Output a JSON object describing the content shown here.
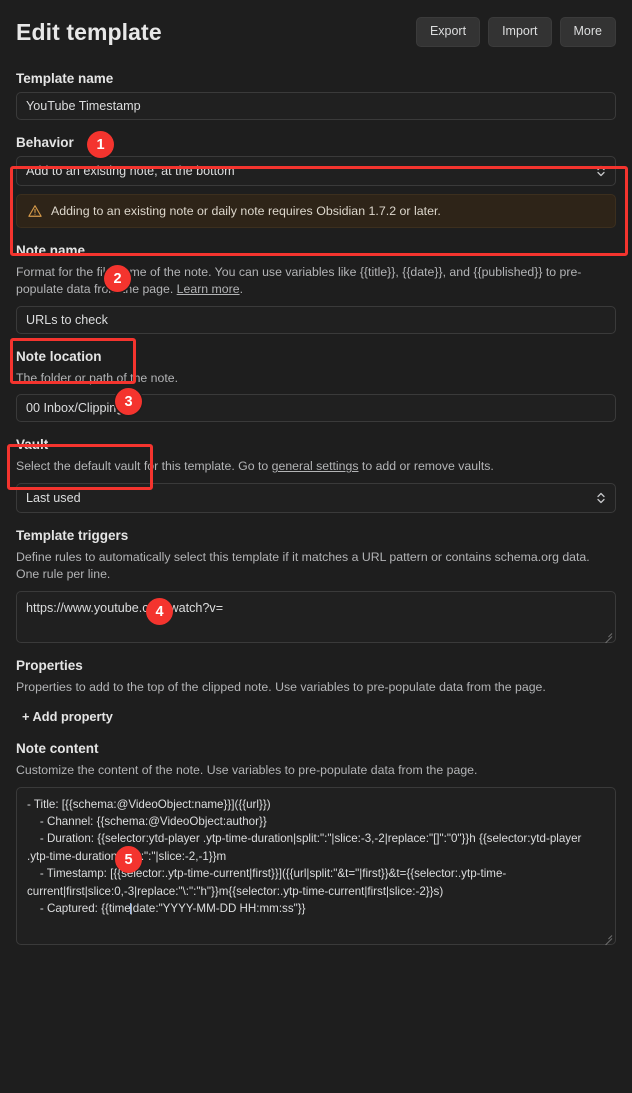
{
  "header": {
    "title": "Edit template",
    "buttons": [
      {
        "label": "Export",
        "name": "export-button"
      },
      {
        "label": "Import",
        "name": "import-button"
      },
      {
        "label": "More",
        "name": "more-button"
      }
    ]
  },
  "template_name": {
    "label": "Template name",
    "value": "YouTube Timestamp"
  },
  "behavior": {
    "label": "Behavior",
    "selected": "Add to an existing note, at the bottom",
    "notice": "Adding to an existing note or daily note requires Obsidian 1.7.2 or later.",
    "notice_icon": "warning-triangle-icon"
  },
  "note_name": {
    "label": "Note name",
    "desc_before": "Format for the file name of the note. You can use variables like {{title}}, {{date}}, and {{published}} to pre-populate data from the page. ",
    "desc_link": "Learn more",
    "desc_after": ".",
    "value": "URLs to check"
  },
  "note_location": {
    "label": "Note location",
    "desc": "The folder or path of the note.",
    "value": "00 Inbox/Clippings"
  },
  "vault": {
    "label": "Vault",
    "desc_before": "Select the default vault for this template. Go to ",
    "desc_link": "general settings",
    "desc_after": " to add or remove vaults.",
    "selected": "Last used"
  },
  "template_triggers": {
    "label": "Template triggers",
    "desc": "Define rules to automatically select this template if it matches a URL pattern or contains schema.org data. One rule per line.",
    "value": "https://www.youtube.com/watch?v="
  },
  "properties": {
    "label": "Properties",
    "desc": "Properties to add to the top of the clipped note. Use variables to pre-populate data from the page.",
    "add_label": "+ Add property"
  },
  "note_content": {
    "label": "Note content",
    "desc": "Customize the content of the note. Use variables to pre-populate data from the page.",
    "value_before_caret": "- Title: [{{schema:@VideoObject:name}}]({{url}})\n    - Channel: {{schema:@VideoObject:author}}\n    - Duration: {{selector:ytd-player .ytp-time-duration|split:\":\"|slice:-3,-2|replace:\"[]\":\"0\"}}h {{selector:ytd-player .ytp-time-duration|split:\":\"|slice:-2,-1}}m\n    - Timestamp: [{{selector:.ytp-time-current|first}}]({{url|split:\"&t=\"|first}}&t={{selector:.ytp-time-current|first|slice:0,-3|replace:\"\\:\":\"h\"}}m{{selector:.ytp-time-current|first|slice:-2}}s)\n    - Captured: {{time",
    "value_after_caret": "|date:\"YYYY-MM-DD HH:mm:ss\"}}"
  },
  "annotations": {
    "badges": [
      {
        "number": "1",
        "name": "annotation-badge-1"
      },
      {
        "number": "2",
        "name": "annotation-badge-2"
      },
      {
        "number": "3",
        "name": "annotation-badge-3"
      },
      {
        "number": "4",
        "name": "annotation-badge-4"
      },
      {
        "number": "5",
        "name": "annotation-badge-5"
      }
    ],
    "highlight_color": "#f4342e"
  }
}
